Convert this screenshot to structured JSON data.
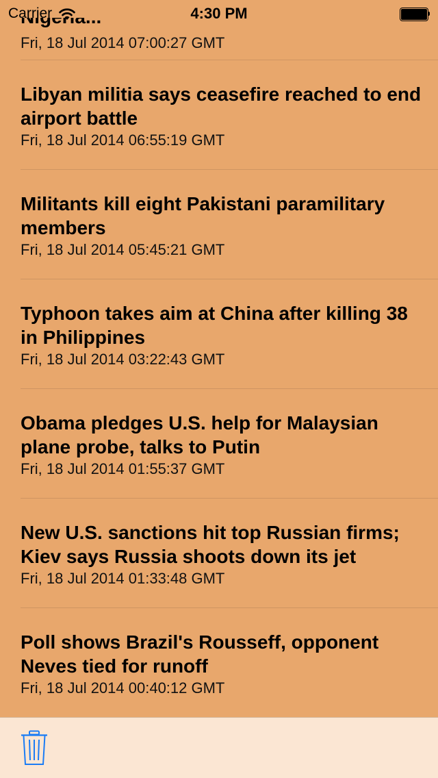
{
  "status_bar": {
    "carrier": "Carrier",
    "time": "4:30 PM"
  },
  "news": {
    "partial_item": {
      "title": "Nigeria...",
      "date": "Fri, 18 Jul 2014 07:00:27 GMT"
    },
    "items": [
      {
        "title": "Libyan militia says ceasefire reached to end airport battle",
        "date": "Fri, 18 Jul 2014 06:55:19 GMT"
      },
      {
        "title": "Militants kill eight Pakistani paramilitary members",
        "date": "Fri, 18 Jul 2014 05:45:21 GMT"
      },
      {
        "title": "Typhoon takes aim at China after killing 38 in Philippines",
        "date": "Fri, 18 Jul 2014 03:22:43 GMT"
      },
      {
        "title": "Obama pledges U.S. help for Malaysian plane probe, talks to Putin",
        "date": "Fri, 18 Jul 2014 01:55:37 GMT"
      },
      {
        "title": "New U.S. sanctions hit top Russian firms; Kiev says Russia shoots down its jet",
        "date": "Fri, 18 Jul 2014 01:33:48 GMT"
      },
      {
        "title": "Poll shows Brazil's Rousseff, opponent Neves tied for runoff",
        "date": "Fri, 18 Jul 2014 00:40:12 GMT"
      }
    ]
  },
  "toolbar": {
    "trash_icon": "trash-icon"
  },
  "colors": {
    "list_background": "#e8a76c",
    "toolbar_background": "#fbe6d3",
    "accent": "#1a7cf5"
  }
}
